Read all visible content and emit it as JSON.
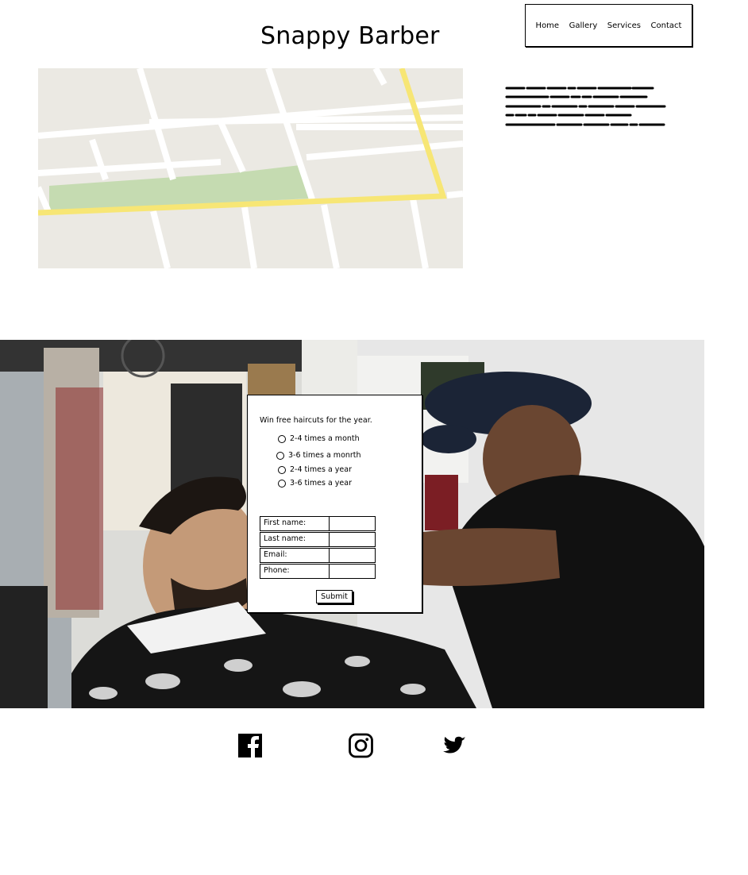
{
  "header": {
    "title": "Snappy Barber",
    "nav": [
      "Home",
      "Gallery",
      "Services",
      "Contact"
    ]
  },
  "map": {
    "colors": {
      "land": "#ebe9e3",
      "road": "#ffffff",
      "highway": "#f7e675",
      "park": "#c5dbb1"
    }
  },
  "form": {
    "heading": "Win free haircuts for the year.",
    "options": [
      "2-4 times a month",
      "3-6 times a monrth",
      "2-4 times a year",
      "3-6 times a year"
    ],
    "fields": [
      "First name:",
      "Last name:",
      "Email:",
      "Phone:"
    ],
    "submit_label": "Submit"
  },
  "social": {
    "icons": [
      "facebook-icon",
      "instagram-icon",
      "twitter-icon"
    ]
  }
}
